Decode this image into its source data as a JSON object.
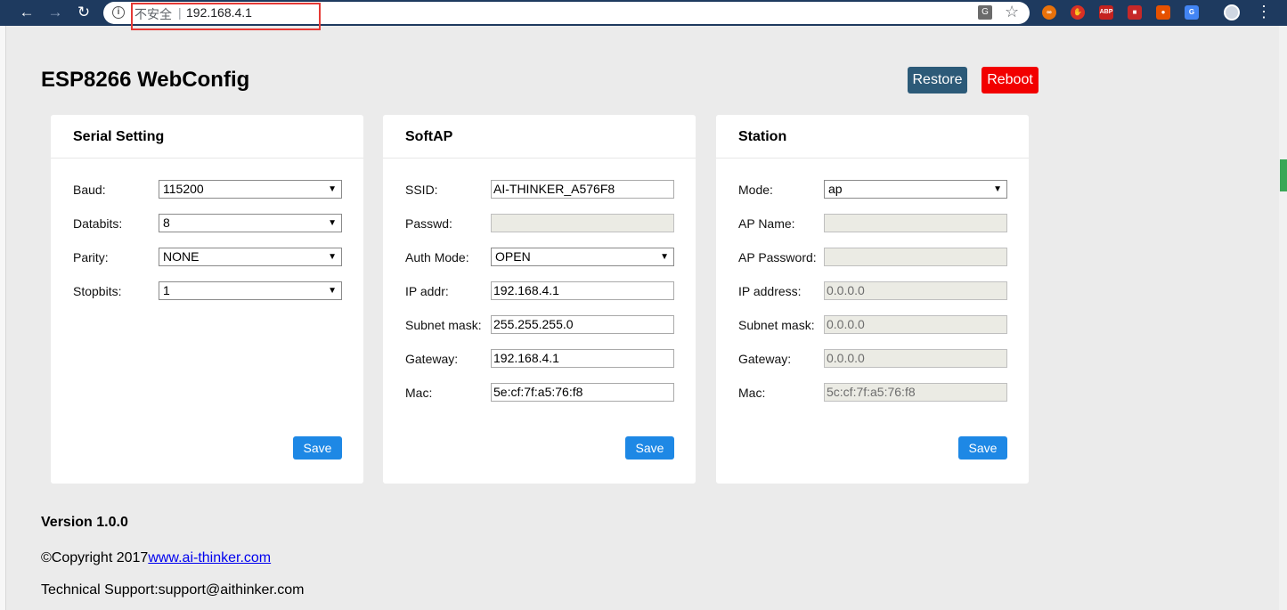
{
  "browser": {
    "security_label": "不安全",
    "separator": "|",
    "url": "192.168.4.1",
    "extensions": [
      "ABP"
    ]
  },
  "page": {
    "title": "ESP8266 WebConfig",
    "restore_label": "Restore",
    "reboot_label": "Reboot"
  },
  "serial": {
    "title": "Serial Setting",
    "baud_label": "Baud:",
    "baud_value": "115200",
    "databits_label": "Databits:",
    "databits_value": "8",
    "parity_label": "Parity:",
    "parity_value": "NONE",
    "stopbits_label": "Stopbits:",
    "stopbits_value": "1",
    "save_label": "Save"
  },
  "softap": {
    "title": "SoftAP",
    "ssid_label": "SSID:",
    "ssid_value": "AI-THINKER_A576F8",
    "passwd_label": "Passwd:",
    "passwd_value": "",
    "auth_label": "Auth Mode:",
    "auth_value": "OPEN",
    "ip_label": "IP addr:",
    "ip_value": "192.168.4.1",
    "mask_label": "Subnet mask:",
    "mask_value": "255.255.255.0",
    "gateway_label": "Gateway:",
    "gateway_value": "192.168.4.1",
    "mac_label": "Mac:",
    "mac_value": "5e:cf:7f:a5:76:f8",
    "save_label": "Save"
  },
  "station": {
    "title": "Station",
    "mode_label": "Mode:",
    "mode_value": "ap",
    "apname_label": "AP Name:",
    "apname_value": "",
    "appass_label": "AP Password:",
    "appass_value": "",
    "ip_label": "IP address:",
    "ip_value": "0.0.0.0",
    "mask_label": "Subnet mask:",
    "mask_value": "0.0.0.0",
    "gateway_label": "Gateway:",
    "gateway_value": "0.0.0.0",
    "mac_label": "Mac:",
    "mac_value": "5c:cf:7f:a5:76:f8",
    "save_label": "Save"
  },
  "footer": {
    "version": "Version 1.0.0",
    "copyright_prefix": "©Copyright 2017",
    "copyright_link": "www.ai-thinker.com",
    "support": "Technical Support:support@aithinker.com"
  },
  "colors": {
    "restore_bg": "#2c5a78",
    "reboot_bg": "#f20000",
    "save_bg": "#1e88e5",
    "page_bg": "#ebebeb"
  }
}
